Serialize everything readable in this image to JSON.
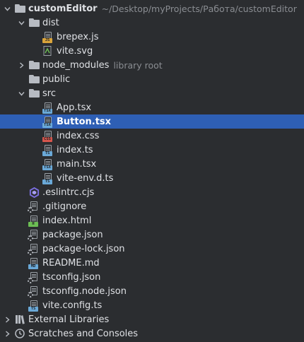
{
  "tree": [
    {
      "key": "root",
      "label": "customEditor",
      "hint": "~/Desktop/myProjects/Работа/customEditor",
      "type": "folder",
      "bold": true,
      "depth": 0,
      "expanded": true
    },
    {
      "key": "dist",
      "label": "dist",
      "type": "folder",
      "depth": 1,
      "expanded": true
    },
    {
      "key": "brepex",
      "label": "brepex.js",
      "type": "file",
      "tag": "JS",
      "tagColor": "#d9a43b",
      "depth": 2
    },
    {
      "key": "vitesvg",
      "label": "vite.svg",
      "type": "svg",
      "depth": 2
    },
    {
      "key": "nodemodules",
      "label": "node_modules",
      "hint": "library root",
      "type": "folder",
      "depth": 1,
      "expanded": false
    },
    {
      "key": "public",
      "label": "public",
      "type": "folder",
      "depth": 1
    },
    {
      "key": "src",
      "label": "src",
      "type": "folder",
      "depth": 1,
      "expanded": true
    },
    {
      "key": "apptsx",
      "label": "App.tsx",
      "type": "file",
      "tag": "TSX",
      "tagColor": "#6aa9d8",
      "depth": 2
    },
    {
      "key": "buttontsx",
      "label": "Button.tsx",
      "type": "file",
      "tag": "TSX",
      "tagColor": "#6aa9d8",
      "depth": 2,
      "selected": true
    },
    {
      "key": "indexcss",
      "label": "index.css",
      "type": "file",
      "tag": "CSS",
      "tagColor": "#d6564d",
      "depth": 2
    },
    {
      "key": "indexts",
      "label": "index.ts",
      "type": "file",
      "tag": "TS",
      "tagColor": "#6aa9d8",
      "depth": 2
    },
    {
      "key": "maintsx",
      "label": "main.tsx",
      "type": "file",
      "tag": "TSX",
      "tagColor": "#6aa9d8",
      "depth": 2
    },
    {
      "key": "viteenv",
      "label": "vite-env.d.ts",
      "type": "file",
      "tag": "TS",
      "tagColor": "#6aa9d8",
      "depth": 2
    },
    {
      "key": "eslintrc",
      "label": ".eslintrc.cjs",
      "type": "eslint",
      "depth": 1
    },
    {
      "key": "gitignore",
      "label": ".gitignore",
      "type": "config",
      "depth": 1
    },
    {
      "key": "indexhtml",
      "label": "index.html",
      "type": "file",
      "tag": "H",
      "tagColor": "#6cbd54",
      "depth": 1
    },
    {
      "key": "packagejson",
      "label": "package.json",
      "type": "config",
      "depth": 1
    },
    {
      "key": "packagelock",
      "label": "package-lock.json",
      "type": "config",
      "depth": 1
    },
    {
      "key": "readme",
      "label": "README.md",
      "type": "file",
      "tag": "MD",
      "tagColor": "#6aa9d8",
      "depth": 1
    },
    {
      "key": "tsconfig",
      "label": "tsconfig.json",
      "type": "config",
      "depth": 1
    },
    {
      "key": "tsconfignode",
      "label": "tsconfig.node.json",
      "type": "config",
      "depth": 1
    },
    {
      "key": "viteconfig",
      "label": "vite.config.ts",
      "type": "file",
      "tag": "TS",
      "tagColor": "#6aa9d8",
      "depth": 1
    },
    {
      "key": "extlibs",
      "label": "External Libraries",
      "type": "libraries",
      "depth": 0,
      "expanded": false
    },
    {
      "key": "scratches",
      "label": "Scratches and Consoles",
      "type": "scratches",
      "depth": 0,
      "expanded": false
    }
  ]
}
